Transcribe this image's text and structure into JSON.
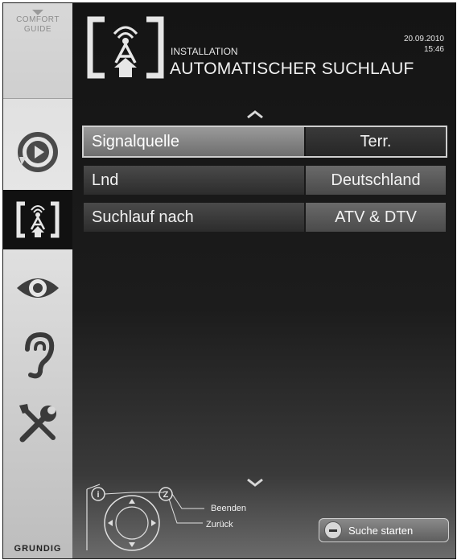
{
  "sidebar": {
    "comfort_line1": "COMFORT",
    "comfort_line2": "GUIDE",
    "items": [
      {
        "icon": "source-icon"
      },
      {
        "icon": "installation-antenna-icon",
        "active": true
      },
      {
        "icon": "eye-icon"
      },
      {
        "icon": "ear-icon"
      },
      {
        "icon": "tools-icon"
      }
    ],
    "brand": "GRUNDIG"
  },
  "header": {
    "category": "INSTALLATION",
    "title": "AUTOMATISCHER SUCHLAUF",
    "date": "20.09.2010",
    "time": "15:46"
  },
  "menu": {
    "rows": [
      {
        "label": "Signalquelle",
        "value": "Terr.",
        "selected": true
      },
      {
        "label": "Lnd",
        "value": "Deutschland",
        "selected": false
      },
      {
        "label": "Suchlauf nach",
        "value": "ATV & DTV",
        "selected": false
      }
    ]
  },
  "footer": {
    "hint_exit": "Beenden",
    "hint_back": "Zurück",
    "remote_key_i": "i",
    "remote_key_z": "Z",
    "start_button": "Suche starten"
  },
  "colors": {
    "background": "#181818",
    "sidebar": "#dcdcdc",
    "text": "#f2f2f2",
    "selected_label": "#8a8a8a"
  }
}
